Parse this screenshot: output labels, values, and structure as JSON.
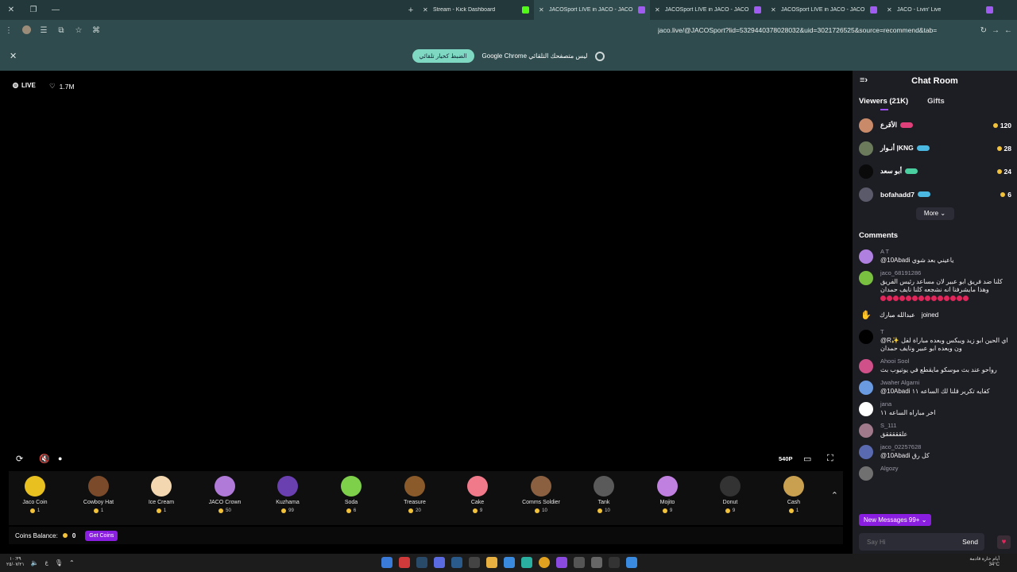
{
  "browser": {
    "tabs": [
      {
        "title": "Stream - Kick Dashboard",
        "favicon_color": "#53fc18",
        "active": false
      },
      {
        "title": "JACOSport LIVE in JACO - JACO",
        "favicon_color": "#a05cf0",
        "active": true
      },
      {
        "title": "JACOSport LIVE in JACO - JACO",
        "favicon_color": "#a05cf0",
        "active": false
      },
      {
        "title": "JACOSport LIVE in JACO - JACO",
        "favicon_color": "#a05cf0",
        "active": false
      },
      {
        "title": "JACO - Livin' Live",
        "favicon_color": "#a05cf0",
        "active": false
      }
    ],
    "url": "jaco.live/@JACOSport?lid=5329440378028032&uid=3021726525&source=recommend&tab="
  },
  "infobar": {
    "message": "Google Chrome ليس متصفحك التلقائي",
    "button": "الضبط كخيار تلقائي"
  },
  "stream": {
    "live_label": "LIVE",
    "likes": "1.7M",
    "quality": "540P"
  },
  "gifts": [
    {
      "name": "Jaco Coin",
      "price": "1",
      "color": "#e8c020"
    },
    {
      "name": "Cowboy Hat",
      "price": "1",
      "color": "#7a4a2a"
    },
    {
      "name": "Ice Cream",
      "price": "1",
      "color": "#f3d7b0"
    },
    {
      "name": "JACO Crown",
      "price": "50",
      "color": "#b07ad8"
    },
    {
      "name": "Kuzhama",
      "price": "99",
      "color": "#6a3fb0"
    },
    {
      "name": "Soda",
      "price": "6",
      "color": "#7ecf4a"
    },
    {
      "name": "Treasure",
      "price": "20",
      "color": "#8a5a2a"
    },
    {
      "name": "Cake",
      "price": "9",
      "color": "#f07a8a"
    },
    {
      "name": "Comms Soldier",
      "price": "10",
      "color": "#8a6040"
    },
    {
      "name": "Tank",
      "price": "10",
      "color": "#5a5a5a"
    },
    {
      "name": "Mojito",
      "price": "9",
      "color": "#c080e0"
    },
    {
      "name": "Donut",
      "price": "9",
      "color": "#333333"
    },
    {
      "name": "Cash",
      "price": "1",
      "color": "#c9a050"
    }
  ],
  "balance": {
    "label": "Coins Balance:",
    "value": "0",
    "button": "Get Coins"
  },
  "chat": {
    "title": "Chat Room",
    "tab_viewers": "Viewers (21K)",
    "tab_gifts": "Gifts",
    "viewers": [
      {
        "name": "الأقرع",
        "coins": "120",
        "avatar_color": "#c98a6a",
        "badge_color": "#e0407a"
      },
      {
        "name": "أنـوار |KNG",
        "coins": "28",
        "avatar_color": "#6a7a5a",
        "badge_color": "#4ab8e0"
      },
      {
        "name": "أبو سعد",
        "coins": "24",
        "avatar_color": "#0a0a0a",
        "badge_color": "#4ad0a0"
      },
      {
        "name": "bofahadd7",
        "coins": "6",
        "avatar_color": "#5a5a6a",
        "badge_color": "#4ab8e0"
      }
    ],
    "more": "More",
    "comments_title": "Comments",
    "comments": [
      {
        "name": "A T",
        "text": "@10Abadi ياعيني بعد شوي",
        "avatar_color": "#b080e0"
      },
      {
        "name": "jaco_68191286",
        "text": "كلنا ضد فريق ابو عبير لان مساعد رئيس الفريق وهذا مايشرفنا انه نشجعه كلنا نايف حمدان",
        "avatar_color": "#7ac040"
      }
    ],
    "joined": {
      "name": "عبدالله مبارك",
      "label": "joined"
    },
    "comments2": [
      {
        "name": "T",
        "text": "@R✨ اي الحين ابو زيد ويبكس وبعده مباراة لفل ون وبعده ابو عبير ونايف حمدان",
        "avatar_color": "#000000"
      },
      {
        "name": "Ahooi Sool",
        "text": "رواحو عند بث موسكو مايقطع في يوتيوب بث",
        "avatar_color": "#d0508a"
      },
      {
        "name": "Jwaher Algarni",
        "text": "@10Abadi كفايه تكرير قلنا لك الساعه ١١",
        "avatar_color": "#6a9ae0"
      },
      {
        "name": "jana",
        "text": "اخر مباراه الساعه ١١",
        "avatar_color": "#ffffff"
      },
      {
        "name": "S_111",
        "text": "علقققققق",
        "avatar_color": "#a07a8a"
      },
      {
        "name": "jaco_02257628",
        "text": "@10Abadi كل رق",
        "avatar_color": "#5a6ab0"
      },
      {
        "name": "Algozy",
        "text": "",
        "avatar_color": "#707070"
      }
    ],
    "new_messages": "New Messages 99+",
    "input_placeholder": "Say Hi",
    "send": "Send"
  },
  "taskbar": {
    "time": "١٠:٣٩",
    "date": "٢٥/٠٧/٢١",
    "weather_label": "أيام حارة قادمة",
    "weather_temp": "34°C"
  }
}
